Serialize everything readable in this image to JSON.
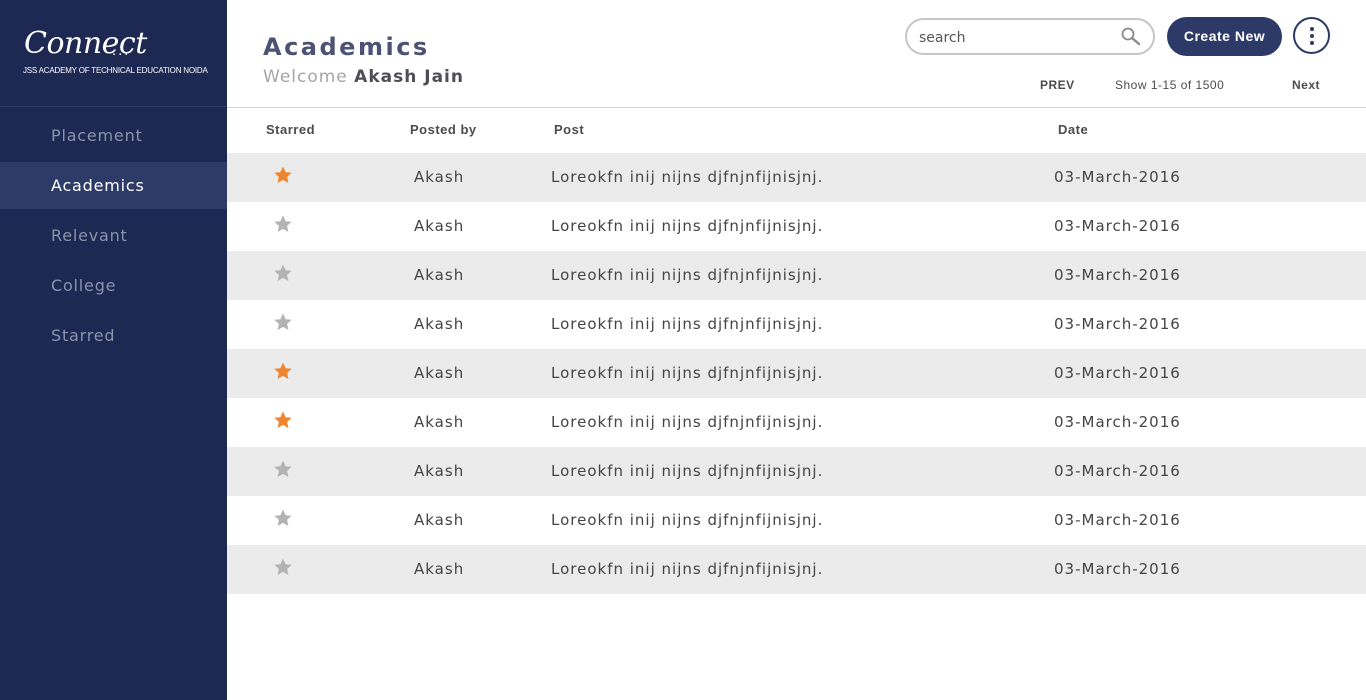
{
  "brand": {
    "script": "Connect",
    "dots": "...",
    "subtitle": "JSS ACADEMY OF TECHNICAL EDUCATION NOIDA"
  },
  "sidebar": {
    "items": [
      {
        "label": "Placement",
        "active": false
      },
      {
        "label": "Academics",
        "active": true
      },
      {
        "label": "Relevant",
        "active": false
      },
      {
        "label": "College",
        "active": false
      },
      {
        "label": "Starred",
        "active": false
      }
    ]
  },
  "header": {
    "title": "Academics",
    "welcome_prefix": "Welcome",
    "user_name": "Akash Jain",
    "search_placeholder": "search",
    "create_label": "Create New",
    "more_icon": "more-vertical-icon"
  },
  "pager": {
    "prev_label": "PREV",
    "info": "Show 1-15 of 1500",
    "next_label": "Next"
  },
  "table": {
    "columns": [
      "Starred",
      "Posted by",
      "Post",
      "Date"
    ],
    "rows": [
      {
        "starred": true,
        "posted_by": "Akash",
        "post": "Loreokfn inij nijns djfnjnfijnisjnj.",
        "date": "03-March-2016"
      },
      {
        "starred": false,
        "posted_by": "Akash",
        "post": "Loreokfn inij nijns djfnjnfijnisjnj.",
        "date": "03-March-2016"
      },
      {
        "starred": false,
        "posted_by": "Akash",
        "post": "Loreokfn inij nijns djfnjnfijnisjnj.",
        "date": "03-March-2016"
      },
      {
        "starred": false,
        "posted_by": "Akash",
        "post": "Loreokfn inij nijns djfnjnfijnisjnj.",
        "date": "03-March-2016"
      },
      {
        "starred": true,
        "posted_by": "Akash",
        "post": "Loreokfn inij nijns djfnjnfijnisjnj.",
        "date": "03-March-2016"
      },
      {
        "starred": true,
        "posted_by": "Akash",
        "post": "Loreokfn inij nijns djfnjnfijnisjnj.",
        "date": "03-March-2016"
      },
      {
        "starred": false,
        "posted_by": "Akash",
        "post": "Loreokfn inij nijns djfnjnfijnisjnj.",
        "date": "03-March-2016"
      },
      {
        "starred": false,
        "posted_by": "Akash",
        "post": "Loreokfn inij nijns djfnjnfijnisjnj.",
        "date": "03-March-2016"
      },
      {
        "starred": false,
        "posted_by": "Akash",
        "post": "Loreokfn inij nijns djfnjnfijnisjnj.",
        "date": "03-March-2016"
      }
    ]
  },
  "colors": {
    "sidebar_bg": "#1d2853",
    "sidebar_active": "#2e3b68",
    "accent": "#2d3a68",
    "star_on": "#f0842c",
    "star_off": "#b3b3b3",
    "row_shade": "#ebebeb"
  }
}
